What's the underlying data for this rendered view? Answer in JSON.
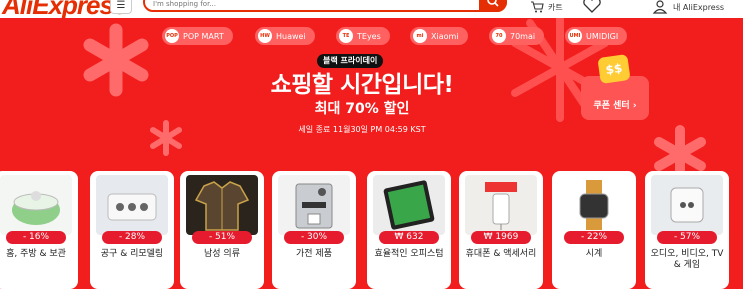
{
  "header": {
    "logo_text": "AliExpress",
    "menu_icon": "menu-icon",
    "search_placeholder": "I'm shopping for...",
    "cart_label": "카트",
    "account_label": "내 AliExpress"
  },
  "brands": [
    {
      "label": "POP MART",
      "logo": "POP"
    },
    {
      "label": "Huawei",
      "logo": "HW"
    },
    {
      "label": "TEyes",
      "logo": "TE"
    },
    {
      "label": "Xiaomi",
      "logo": "mi"
    },
    {
      "label": "70mai",
      "logo": "70"
    },
    {
      "label": "UMIDIGI",
      "logo": "UMI"
    }
  ],
  "promo": {
    "badge": "블랙 프라이데이",
    "headline": "쇼핑할 시간입니다!",
    "subhead": "최대 70% 할인",
    "sale_end": "세일 종료 11월30일 PM 04:59 KST",
    "coupon_label": "쿠폰 센터 ›",
    "coupon_symbol": "$$"
  },
  "categories": [
    {
      "label": "홈, 주방 & 보관",
      "price": "- 16%",
      "icon": "salad-spinner-image"
    },
    {
      "label": "공구 & 리모델링",
      "price": "- 28%",
      "icon": "power-strip-image"
    },
    {
      "label": "남성 의류",
      "price": "- 51%",
      "icon": "patterned-shirt-image"
    },
    {
      "label": "가전 제품",
      "price": "- 30%",
      "icon": "espresso-machine-image"
    },
    {
      "label": "효율적인 오피스텀",
      "price": "₩ 632",
      "icon": "tablet-image"
    },
    {
      "label": "휴대폰 & 액세서리",
      "price": "₩ 1969",
      "icon": "charger-image"
    },
    {
      "label": "시계",
      "price": "- 22%",
      "icon": "smartwatch-image"
    },
    {
      "label": "오디오, 비디오, TV & 게임",
      "price": "- 57%",
      "icon": "smart-plug-image"
    }
  ],
  "colors": {
    "banner": "#f21d1d",
    "brand_red": "#e62e04",
    "price_pill": "#e61c2e"
  }
}
